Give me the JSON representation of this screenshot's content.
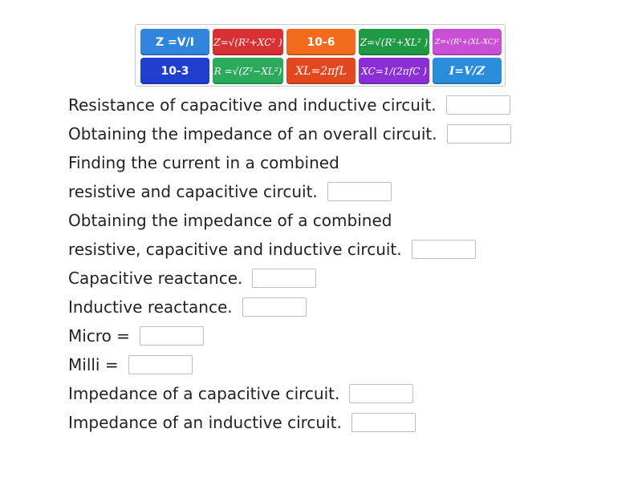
{
  "tiles": [
    {
      "label": "Z =V/I",
      "color": "#2f86dc",
      "style": "plain"
    },
    {
      "label": "Z=√(R²+XC² )",
      "color": "#d93035",
      "style": "math"
    },
    {
      "label": "10-6",
      "color": "#f26a1b",
      "style": "plain"
    },
    {
      "label": "Z=√(R²+XL² )",
      "color": "#1e9a45",
      "style": "math"
    },
    {
      "label": "Z=√(R²+(XL-XC)²",
      "color": "#c94fd6",
      "style": "tiny"
    },
    {
      "label": "10-3",
      "color": "#1f3fcf",
      "style": "plain"
    },
    {
      "label": "R =√(Z²−XL²)",
      "color": "#2aaa5a",
      "style": "math"
    },
    {
      "label": "XL=2πfL",
      "color": "#e2471f",
      "style": "math"
    },
    {
      "label": "XC=1/(2πfC )",
      "color": "#8a2fd6",
      "style": "math"
    },
    {
      "label": "I=V/Z",
      "color": "#2a8ddc",
      "style": "big"
    }
  ],
  "questions": [
    "Resistance of capacitive and inductive circuit.",
    "Obtaining the impedance of an overall circuit.",
    "Finding the current in a combined",
    "resistive and capacitive circuit.",
    "Obtaining the impedance of a combined",
    "resistive, capacitive and inductive circuit.",
    "Capacitive reactance.",
    "Inductive reactance.",
    "Micro =",
    "Milli =",
    "Impedance of a capacitive circuit.",
    "Impedance of an inductive circuit."
  ]
}
